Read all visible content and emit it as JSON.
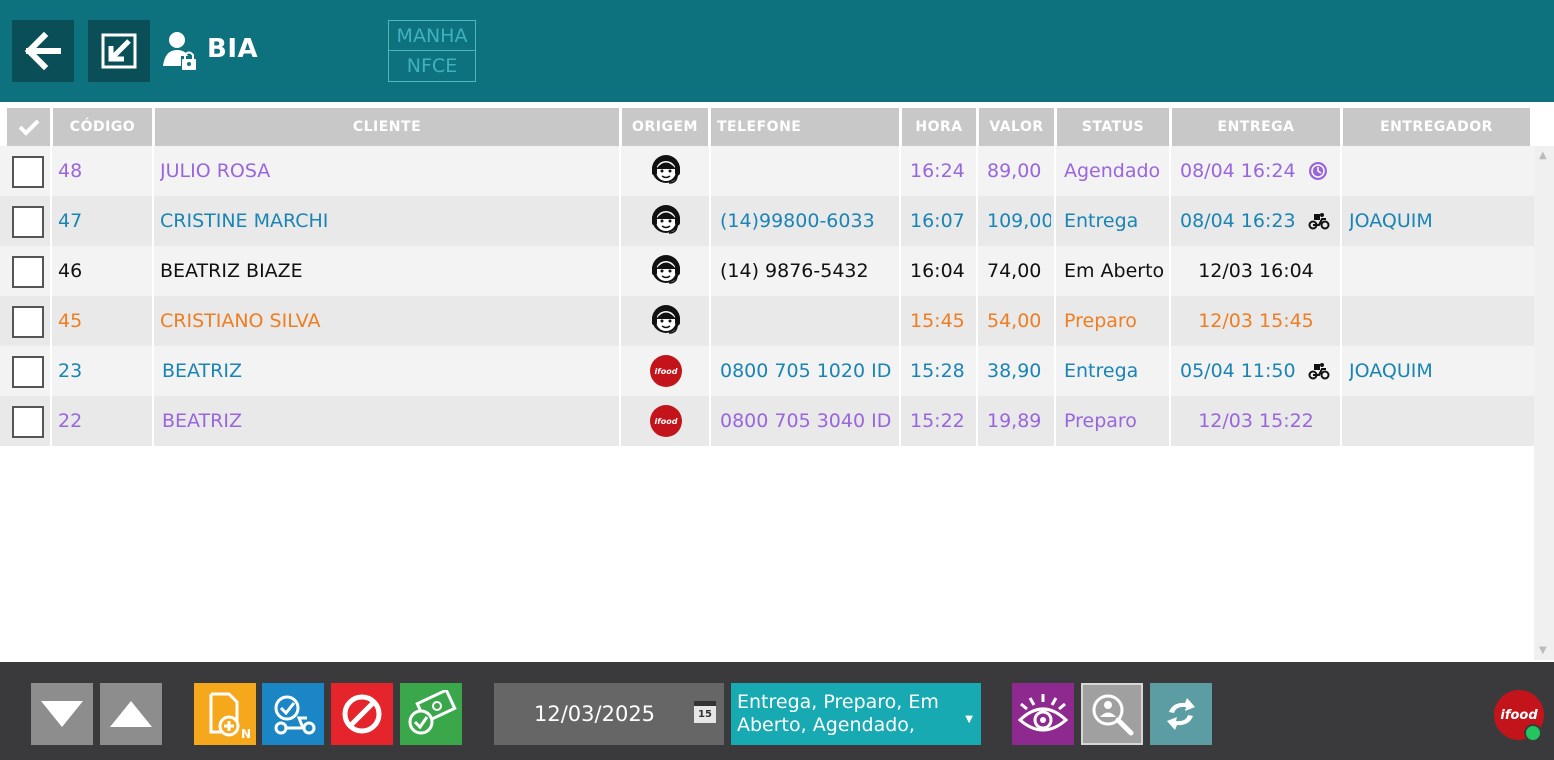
{
  "header": {
    "username": "BIA",
    "shift_label": "MANHA",
    "doc_type": "NFCE",
    "colors": {
      "bg": "#0e727e",
      "button_bg": "#0a4f58"
    }
  },
  "table": {
    "headers": {
      "select": "✔",
      "code": "CÓDIGO",
      "client": "CLIENTE",
      "origin": "ORIGEM",
      "phone": "TELEFONE",
      "time": "HORA",
      "value": "VALOR",
      "status": "STATUS",
      "delivery": "ENTREGA",
      "courier": "ENTREGADOR"
    },
    "rows": [
      {
        "code": "48",
        "client": "JULIO ROSA",
        "origin": "headset-icon",
        "phone": "",
        "time": "16:24",
        "value": "89,00",
        "status": "Agendado",
        "delivery": "08/04 16:24",
        "delivery_icon": "clock-icon",
        "courier": "",
        "color": "purple"
      },
      {
        "code": "47",
        "client": "CRISTINE MARCHI",
        "origin": "headset-icon",
        "phone": "(14)99800-6033",
        "time": "16:07",
        "value": "109,00",
        "status": "Entrega",
        "delivery": "08/04 16:23",
        "delivery_icon": "motorcycle-icon",
        "courier": "JOAQUIM",
        "color": "blue"
      },
      {
        "code": "46",
        "client": "BEATRIZ BIAZE",
        "origin": "headset-icon",
        "phone": "(14) 9876-5432",
        "time": "16:04",
        "value": "74,00",
        "status": "Em Aberto",
        "delivery": "12/03 16:04",
        "delivery_icon": "",
        "courier": "",
        "color": "black"
      },
      {
        "code": "45",
        "client": "CRISTIANO SILVA",
        "origin": "headset-icon",
        "phone": "",
        "time": "15:45",
        "value": "54,00",
        "status": "Preparo",
        "delivery": "12/03 15:45",
        "delivery_icon": "",
        "courier": "",
        "color": "orange"
      },
      {
        "code": "23",
        "client": "BEATRIZ",
        "origin": "ifood-icon",
        "phone": "0800 705 1020 ID",
        "time": "15:28",
        "value": "38,90",
        "status": "Entrega",
        "delivery": "05/04 11:50",
        "delivery_icon": "motorcycle-icon",
        "courier": "JOAQUIM",
        "color": "blue"
      },
      {
        "code": "22",
        "client": "BEATRIZ",
        "origin": "ifood-icon",
        "phone": "0800 705 3040 ID",
        "time": "15:22",
        "value": "19,89",
        "status": "Preparo",
        "delivery": "12/03 15:22",
        "delivery_icon": "",
        "courier": "",
        "color": "purple"
      }
    ],
    "origin_ifood_label": "ifood"
  },
  "footer": {
    "date": "12/03/2025",
    "calendar_day": "15",
    "status_filter": "Entrega, Preparo, Em Aberto, Agendado,",
    "ifood_label": "ifood",
    "colors": {
      "nav_button": "#8d8d8d",
      "new_order": "#f5a81c",
      "dispatch": "#1b86c5",
      "cancel": "#e5252b",
      "payment": "#3aa74b",
      "view": "#8e2a8f",
      "search": "#a0a0a0",
      "refresh": "#5b9da3"
    }
  }
}
